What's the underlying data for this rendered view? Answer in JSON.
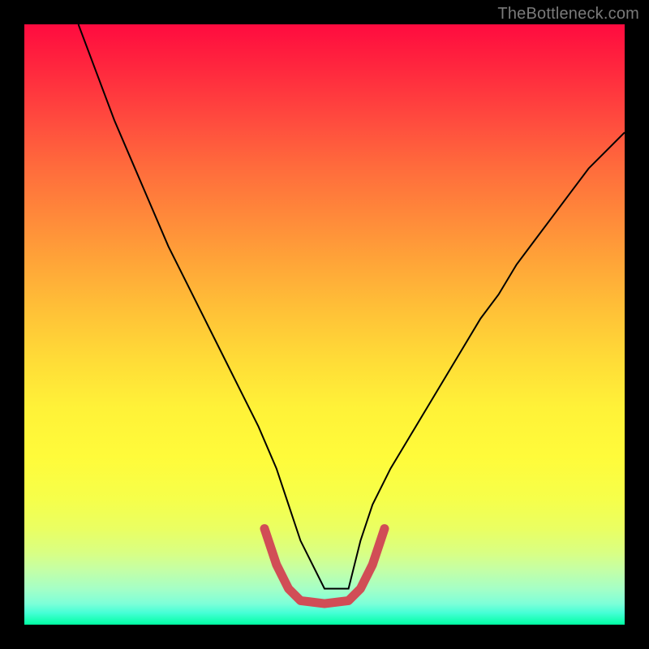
{
  "watermark": "TheBottleneck.com",
  "chart_data": {
    "type": "line",
    "title": "",
    "xlabel": "",
    "ylabel": "",
    "xlim": [
      0,
      100
    ],
    "ylim": [
      0,
      100
    ],
    "background_gradient": {
      "top_color": "#ff0b3f",
      "bottom_color": "#00ffa3",
      "stops": [
        {
          "pos": 0,
          "color": "#ff0b3f"
        },
        {
          "pos": 0.25,
          "color": "#ff893a"
        },
        {
          "pos": 0.55,
          "color": "#ffdc37"
        },
        {
          "pos": 0.8,
          "color": "#f6ff4a"
        },
        {
          "pos": 1.0,
          "color": "#00ffa3"
        }
      ]
    },
    "series": [
      {
        "name": "black-curve",
        "color": "#000000",
        "stroke_width": 2,
        "x": [
          9,
          12,
          15,
          18,
          21,
          24,
          27,
          30,
          33,
          36,
          39,
          42,
          44,
          46,
          50,
          54,
          56,
          58,
          61,
          64,
          67,
          70,
          73,
          76,
          79,
          82,
          85,
          88,
          91,
          94,
          97,
          100
        ],
        "y": [
          100,
          92,
          84,
          77,
          70,
          63,
          57,
          51,
          45,
          39,
          33,
          26,
          20,
          14,
          6,
          6,
          14,
          20,
          26,
          31,
          36,
          41,
          46,
          51,
          55,
          60,
          64,
          68,
          72,
          76,
          79,
          82
        ]
      },
      {
        "name": "red-bracket",
        "color": "#d14d56",
        "stroke_width": 10,
        "linecap": "round",
        "x": [
          40,
          42,
          44,
          46,
          50,
          54,
          56,
          58,
          60
        ],
        "y": [
          16,
          10,
          6,
          4,
          3.5,
          4,
          6,
          10,
          16
        ]
      }
    ]
  }
}
